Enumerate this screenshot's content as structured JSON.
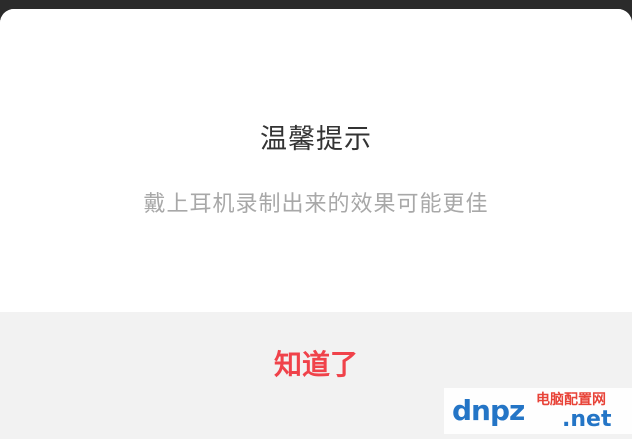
{
  "dialog": {
    "title": "温馨提示",
    "message": "戴上耳机录制出来的效果可能更佳",
    "confirm_label": "知道了"
  },
  "watermark": {
    "brand_text": "dnpz",
    "site_name": "电脑配置网",
    "domain_suffix": ".net"
  },
  "colors": {
    "confirm": "#f0424a",
    "title": "#333333",
    "message": "#a8a8a8",
    "footer_bg": "#f2f2f2",
    "backdrop": "#2b2b2b",
    "watermark_blue": "#1a6fc4",
    "watermark_red": "#e83a2f"
  }
}
